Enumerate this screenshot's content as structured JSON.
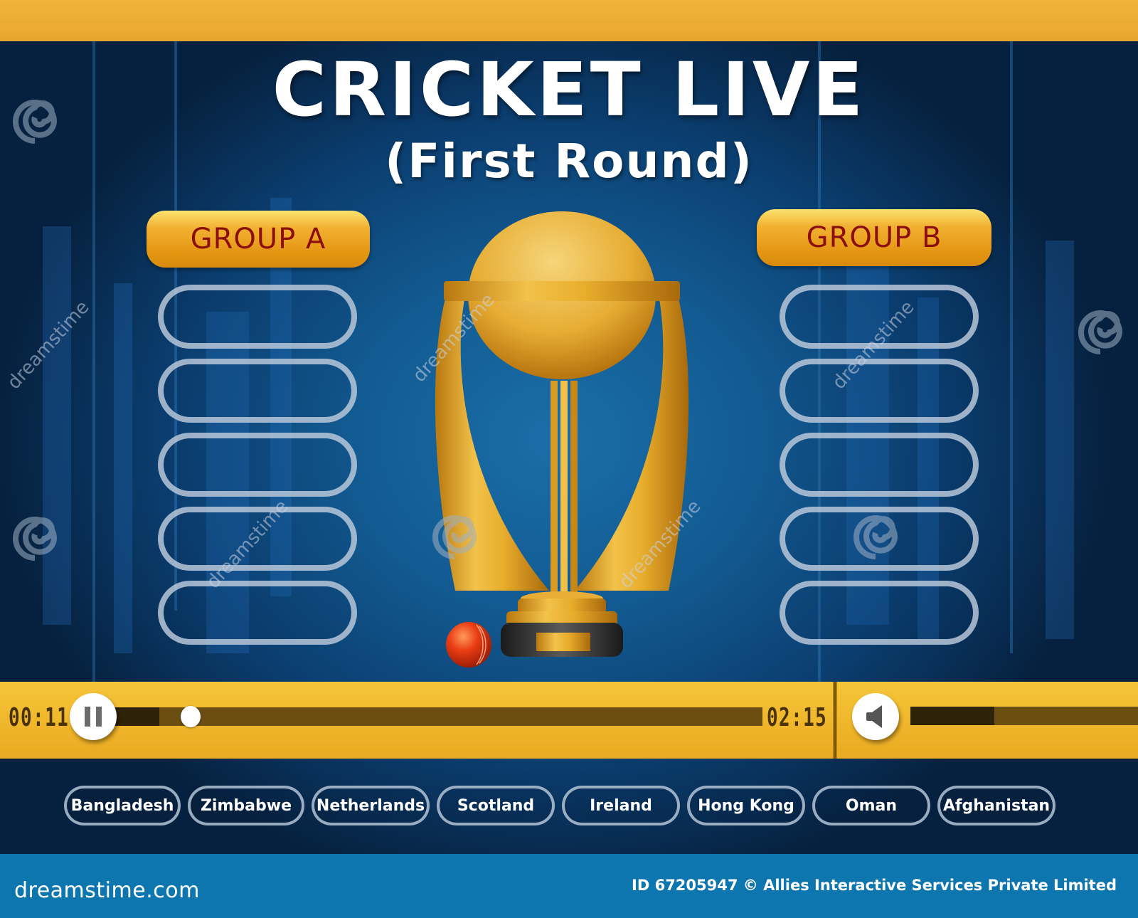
{
  "header": {
    "title": "CRICKET LIVE",
    "subtitle": "(First Round)"
  },
  "groups": [
    {
      "label": "GROUP A",
      "slots": [
        "",
        "",
        "",
        "",
        ""
      ]
    },
    {
      "label": "GROUP B",
      "slots": [
        "",
        "",
        "",
        "",
        ""
      ]
    }
  ],
  "player": {
    "current_time": "00:11",
    "total_time": "02:15",
    "progress_fraction": 0.08,
    "volume_fraction": 0.37,
    "pause_icon": "pause-icon",
    "volume_icon": "speaker-icon"
  },
  "teams": [
    "Bangladesh",
    "Zimbabwe",
    "Netherlands",
    "Scotland",
    "Ireland",
    "Hong Kong",
    "Oman",
    "Afghanistan"
  ],
  "footer": {
    "logo": "dreamstime.com",
    "credit": "ID 67205947 © Allies Interactive Services Private Limited"
  },
  "watermark": {
    "text": "dreamstime"
  },
  "colors": {
    "accent_gold": "#f0b82c",
    "group_label": "#8b0f0f",
    "background_blue": "#125a91",
    "footer_blue": "#0e76ae"
  }
}
